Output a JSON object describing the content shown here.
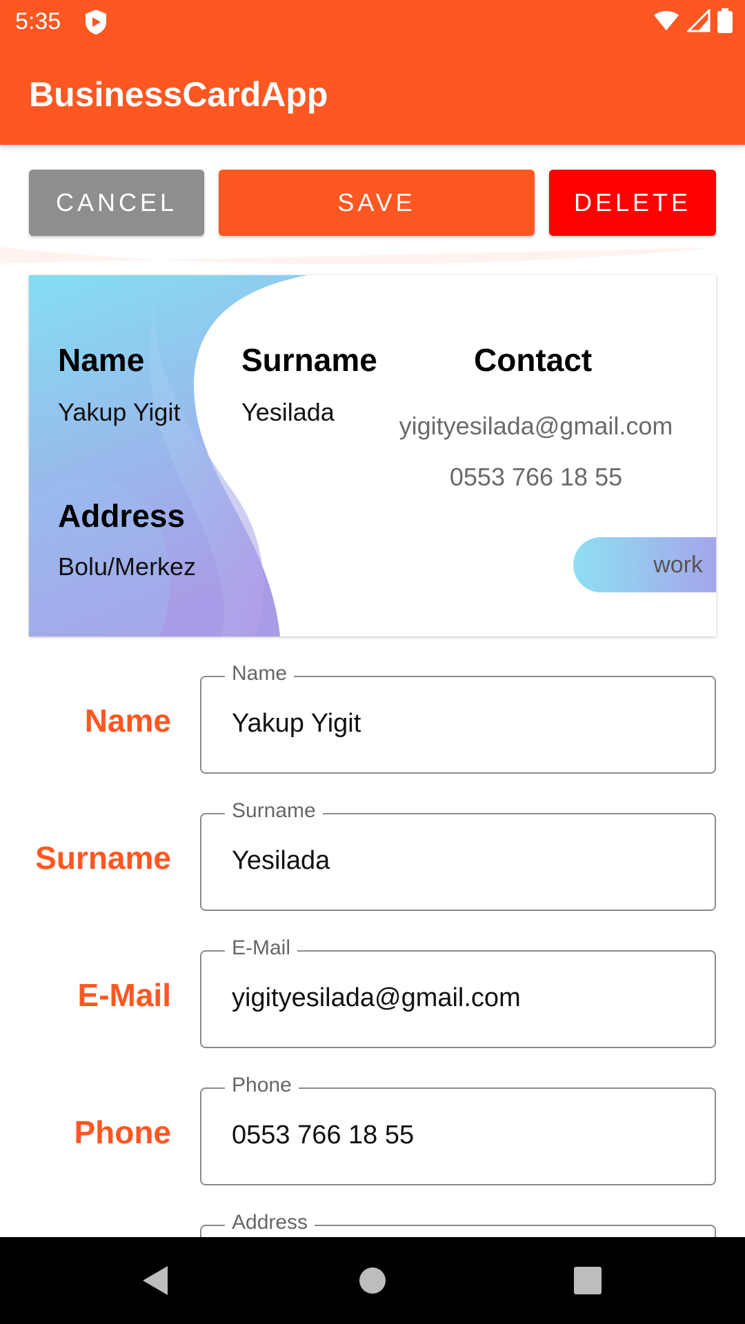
{
  "status_bar": {
    "time": "5:35"
  },
  "app_bar": {
    "title": "BusinessCardApp"
  },
  "actions": {
    "cancel": "CANCEL",
    "save": "SAVE",
    "delete": "DELETE"
  },
  "card": {
    "name_label": "Name",
    "name_value": "Yakup Yigit",
    "surname_label": "Surname",
    "surname_value": "Yesilada",
    "contact_label": "Contact",
    "email": "yigityesilada@gmail.com",
    "phone": "0553 766 18 55",
    "address_label": "Address",
    "address_value": "Bolu/Merkez",
    "tag": "work"
  },
  "form": {
    "rows": [
      {
        "label": "Name",
        "field_label": "Name",
        "value": "Yakup Yigit"
      },
      {
        "label": "Surname",
        "field_label": "Surname",
        "value": "Yesilada"
      },
      {
        "label": "E-Mail",
        "field_label": "E-Mail",
        "value": "yigityesilada@gmail.com"
      },
      {
        "label": "Phone",
        "field_label": "Phone",
        "value": "0553 766 18 55"
      },
      {
        "label": "",
        "field_label": "Address",
        "value": ""
      }
    ]
  },
  "colors": {
    "accent": "#ff5722",
    "cancel": "#8e8e8e",
    "delete": "#ff0000"
  }
}
